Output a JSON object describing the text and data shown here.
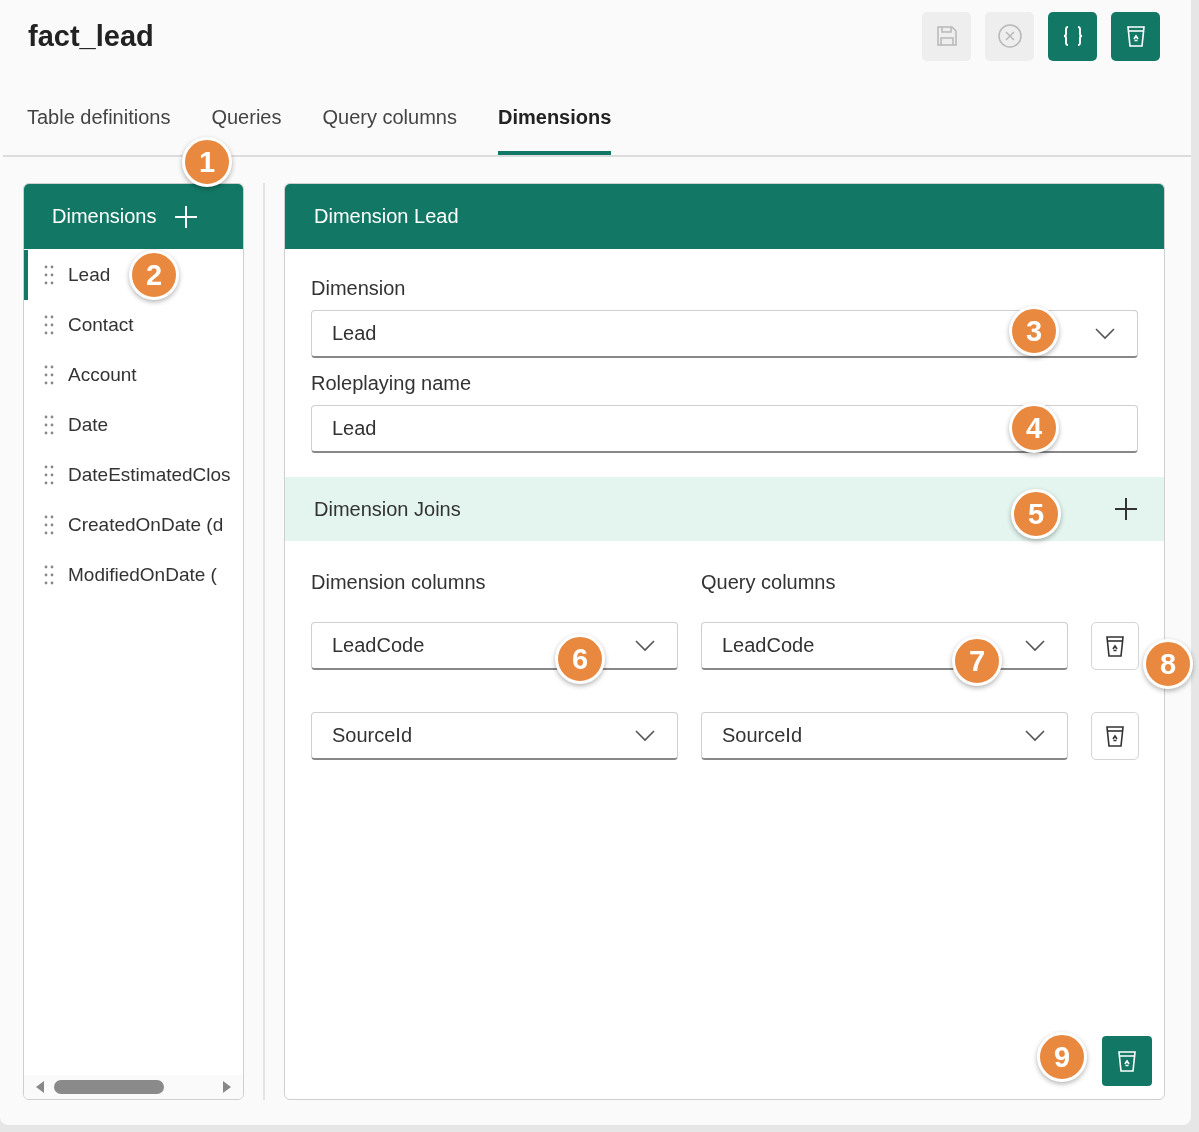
{
  "title": "fact_lead",
  "toolbar": [
    {
      "kind": "save",
      "disabled": true
    },
    {
      "kind": "cancel",
      "disabled": true
    },
    {
      "kind": "json",
      "disabled": false
    },
    {
      "kind": "delete",
      "disabled": false
    }
  ],
  "tabs": [
    {
      "label": "Table definitions",
      "selected": false
    },
    {
      "label": "Queries",
      "selected": false
    },
    {
      "label": "Query columns",
      "selected": false
    },
    {
      "label": "Dimensions",
      "selected": true
    }
  ],
  "sidebar": {
    "title": "Dimensions",
    "items": [
      {
        "label": "Lead",
        "selected": true
      },
      {
        "label": "Contact",
        "selected": false
      },
      {
        "label": "Account",
        "selected": false
      },
      {
        "label": "Date",
        "selected": false
      },
      {
        "label": "DateEstimatedClos",
        "selected": false
      },
      {
        "label": "CreatedOnDate (d",
        "selected": false
      },
      {
        "label": "ModifiedOnDate (",
        "selected": false
      }
    ]
  },
  "detail": {
    "title": "Dimension Lead",
    "dimension": {
      "label": "Dimension",
      "value": "Lead"
    },
    "roleplaying": {
      "label": "Roleplaying name",
      "value": "Lead"
    },
    "joins": {
      "title": "Dimension Joins",
      "columns": [
        "Dimension columns",
        "Query columns"
      ],
      "rows": [
        {
          "dimension_column": "LeadCode",
          "query_column": "LeadCode"
        },
        {
          "dimension_column": "SourceId",
          "query_column": "SourceId"
        }
      ]
    }
  },
  "callouts": [
    "1",
    "2",
    "3",
    "4",
    "5",
    "6",
    "7",
    "8",
    "9"
  ]
}
